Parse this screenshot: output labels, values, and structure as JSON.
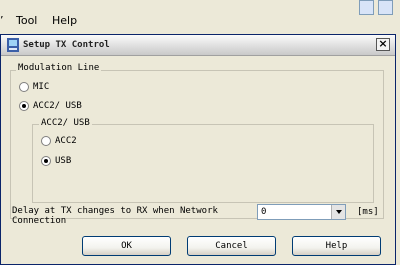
{
  "menubar": {
    "hidden_menu_label": "’",
    "tool_label": "Tool",
    "help_label": "Help"
  },
  "dialog": {
    "title": "Setup TX Control",
    "close_glyph": "×",
    "modulation_group": {
      "label": "Modulation Line",
      "options": [
        {
          "label": "MIC",
          "selected": false
        },
        {
          "label": "ACC2/ USB",
          "selected": true
        }
      ]
    },
    "acc2_group": {
      "label": "ACC2/ USB",
      "options": [
        {
          "label": "ACC2",
          "selected": false
        },
        {
          "label": "USB",
          "selected": true
        }
      ]
    },
    "delay": {
      "label_line1": "Delay at TX changes to RX when Network",
      "label_line2": "Connection",
      "value": "0",
      "unit": "[ms]"
    },
    "buttons": {
      "ok": "OK",
      "cancel": "Cancel",
      "help": "Help"
    }
  }
}
